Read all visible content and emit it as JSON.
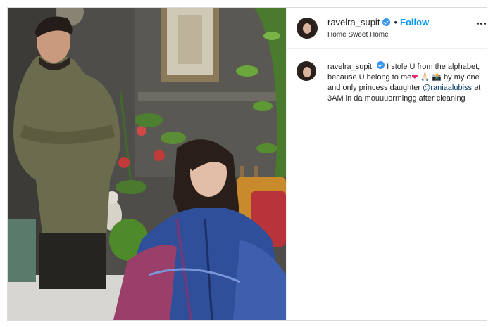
{
  "post": {
    "username": "ravelra_supit",
    "separator": "•",
    "follow_label": "Follow",
    "location": "Home Sweet Home",
    "verified_color": "#3897f0",
    "follow_color": "#0095f6"
  },
  "caption": {
    "username": "ravelra_supit",
    "text_before_mention": "I stole U from the alphabet, because U belong to me",
    "heart_emoji": "❤",
    "emojis": "🙏🏻 📸",
    "text_after_emojis": "by my one and only princess daughter",
    "mention": "@raniaalubiss",
    "text_after_mention": "at 3AM in da mouuuorrningg after cleaning"
  },
  "icons": {
    "verified": "verified-badge-icon",
    "more": "more-options-icon",
    "avatar": "profile-avatar"
  }
}
